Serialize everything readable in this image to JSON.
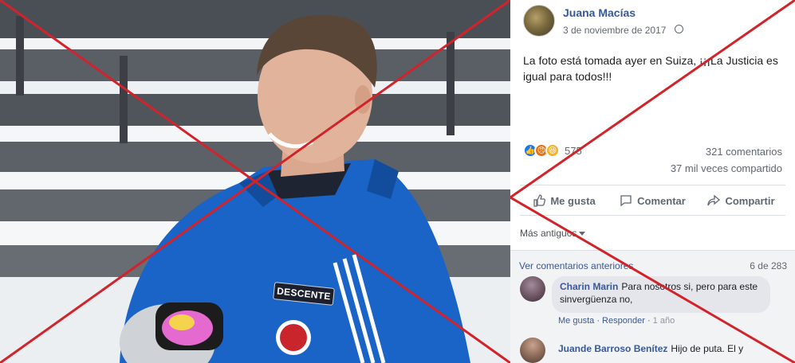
{
  "post": {
    "author": "Juana Macías",
    "date": "3 de noviembre de 2017",
    "text": "La foto está tomada ayer en Suiza, ¡¡¡La Justicia es igual para todos!!!",
    "reaction_count": "575",
    "comments_count": "321 comentarios",
    "shares_count": "37 mil veces compartido"
  },
  "photo": {
    "jacket_badge": "DESCENTE"
  },
  "actions": {
    "like": "Me gusta",
    "comment": "Comentar",
    "share": "Compartir"
  },
  "comments": {
    "sort_label": "Más antiguos",
    "previous_label": "Ver comentarios anteriores",
    "pager": "6 de 283",
    "items": [
      {
        "name": "Charin Marin",
        "text": "Para nosotros si, pero para este sinvergüenza no,",
        "like": "Me gusta",
        "reply": "Responder",
        "time": "1 año"
      },
      {
        "name": "Juande Barroso Benítez",
        "text": "Hijo de puta. El y"
      }
    ]
  },
  "colors": {
    "link_blue": "#385898",
    "cross_red": "#d2232a",
    "jacket_blue": "#1a63c7"
  },
  "icons": [
    "globe-icon",
    "like-icon",
    "comment-icon",
    "share-icon",
    "caret-down-icon"
  ]
}
